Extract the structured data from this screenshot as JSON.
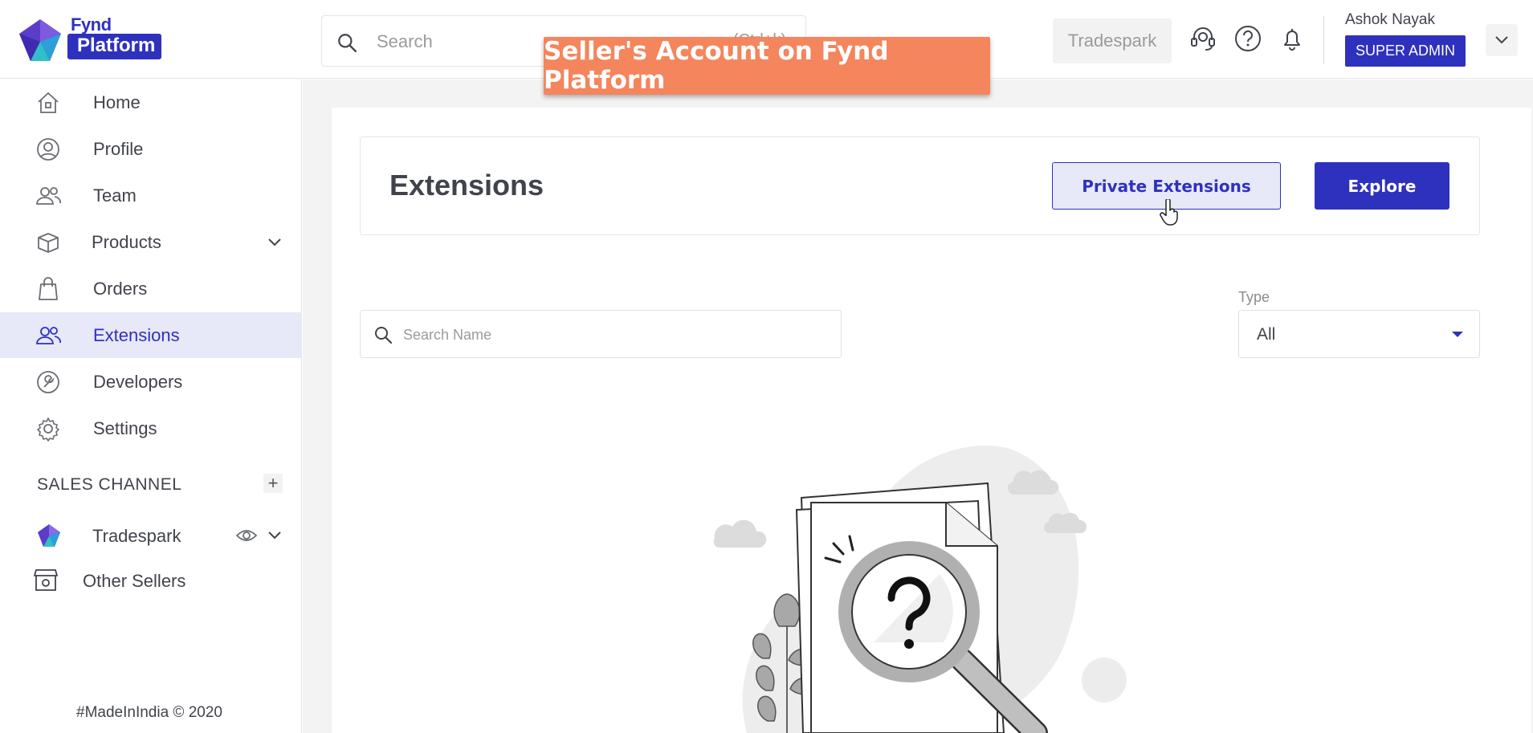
{
  "header": {
    "logo_top": "Fynd",
    "logo_bottom": "Platform",
    "search_placeholder": "Search",
    "search_shortcut": "(Ctrl+k)",
    "company": "Tradespark",
    "user_name": "Ashok Nayak",
    "user_role": "SUPER ADMIN"
  },
  "overlay": {
    "title": "Seller's Account on Fynd Platform"
  },
  "sidebar": {
    "items": [
      {
        "label": "Home",
        "icon": "home-icon"
      },
      {
        "label": "Profile",
        "icon": "profile-icon"
      },
      {
        "label": "Team",
        "icon": "team-icon"
      },
      {
        "label": "Products",
        "icon": "box-icon"
      },
      {
        "label": "Orders",
        "icon": "bag-icon"
      },
      {
        "label": "Extensions",
        "icon": "extensions-icon"
      },
      {
        "label": "Developers",
        "icon": "wrench-icon"
      },
      {
        "label": "Settings",
        "icon": "gear-icon"
      }
    ],
    "active": "Extensions",
    "sales_channel_heading": "SALES CHANNEL",
    "sales_channel_add": "+",
    "channel_name": "Tradespark",
    "other_sellers": "Other Sellers",
    "footer": "#MadeInIndia © 2020"
  },
  "main": {
    "title": "Extensions",
    "private_extensions_label": "Private Extensions",
    "explore_label": "Explore",
    "search_placeholder": "Search Name",
    "type_label": "Type",
    "type_value": "All"
  },
  "colors": {
    "primary": "#2e31be",
    "overlay": "#f4855d",
    "active_bg": "#e7e8f8"
  }
}
